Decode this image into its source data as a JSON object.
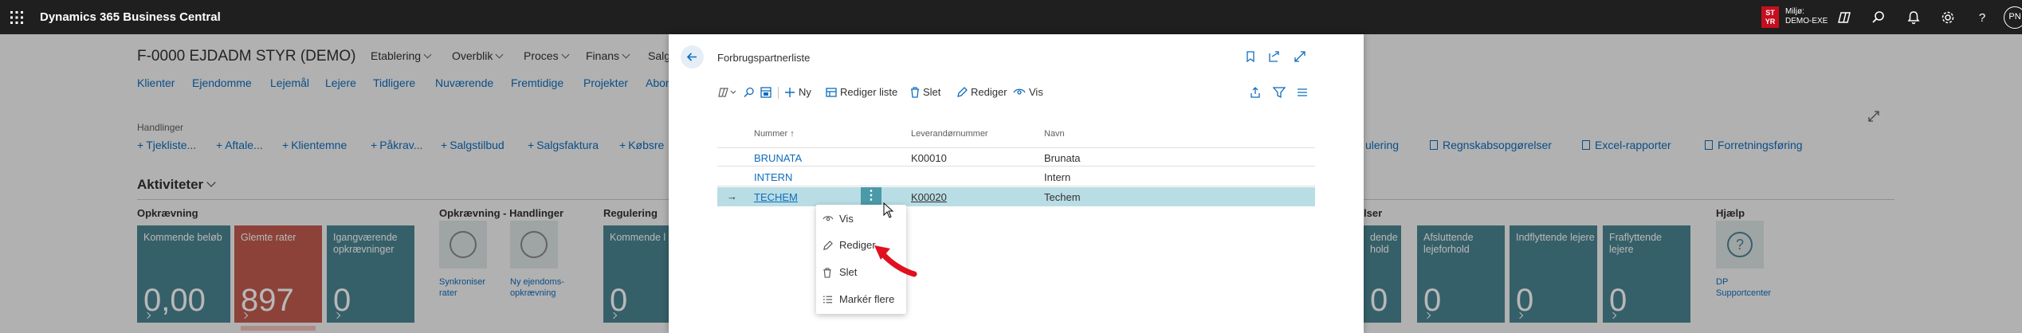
{
  "topbar": {
    "app_title": "Dynamics 365 Business Central",
    "env_badge": "ST\nYR",
    "env_label": "Miljø:",
    "env_name": "DEMO-EXE",
    "user_initials": "PN"
  },
  "page": {
    "title": "F-0000 EJDADM STYR (DEMO)",
    "menus": [
      "Etablering",
      "Overblik",
      "Proces",
      "Finans",
      "Salg"
    ],
    "nav": [
      "Klienter",
      "Ejendomme",
      "Lejemål",
      "Lejere",
      "Tidligere",
      "Nuværende",
      "Fremtidige",
      "Projekter",
      "Abon"
    ],
    "actions_label": "Handlinger",
    "actions": [
      "Tjekliste...",
      "Aftale...",
      "Klientemne",
      "Påkrav...",
      "Salgstilbud",
      "Salgsfaktura",
      "Købsre"
    ],
    "actions_right": [
      "ulering",
      "Regnskabsopgørelser",
      "Excel-rapporter",
      "Forretningsføring"
    ],
    "section_title": "Aktiviteter",
    "groups": {
      "opkraevning": "Opkrævning",
      "opkraevning_handlinger": "Opkrævning - Handlinger",
      "regulering": "Regulering",
      "other": "lser",
      "hjaelp": "Hjælp"
    },
    "tiles_left": [
      {
        "label": "Kommende beløb",
        "value": "0,00",
        "style": "teal"
      },
      {
        "label": "Glemte rater",
        "value": "897",
        "style": "red"
      },
      {
        "label": "Igangværende opkrævninger",
        "value": "0",
        "style": "teal"
      }
    ],
    "circle_actions": [
      {
        "label": "Synkroniser\nrater"
      },
      {
        "label": "Ny ejendoms-\nopkrævning"
      }
    ],
    "tile_regulering": {
      "label": "Kommende l",
      "value": "0"
    },
    "tiles_right": [
      {
        "label": "dende\nhold",
        "value": "0"
      },
      {
        "label": "Afsluttende lejeforhold",
        "value": "0"
      },
      {
        "label": "Indflyttende lejere",
        "value": "0"
      },
      {
        "label": "Fraflyttende lejere",
        "value": "0"
      }
    ],
    "help": {
      "label": "DP\nSupportcenter",
      "icon": "question-icon"
    }
  },
  "dialog": {
    "title": "Forbrugspartnerliste",
    "toolbar": {
      "new": "Ny",
      "edit_list": "Rediger liste",
      "delete": "Slet",
      "edit": "Rediger",
      "view": "Vis"
    },
    "columns": {
      "number": "Nummer",
      "sort": "↑",
      "supplier": "Leverandørnummer",
      "name": "Navn"
    },
    "rows": [
      {
        "number": "BRUNATA",
        "supplier": "K00010",
        "name": "Brunata"
      },
      {
        "number": "INTERN",
        "supplier": "",
        "name": "Intern"
      },
      {
        "number": "TECHEM",
        "supplier": "K00020",
        "name": "Techem"
      }
    ],
    "row_marker": "→",
    "context_menu": [
      "Vis",
      "Rediger",
      "Slet",
      "Markér flere"
    ]
  },
  "colors": {
    "topbar": "#1f1f1f",
    "tile_teal": "#4b8592",
    "tile_red": "#c25c50",
    "link": "#0f6cbd",
    "selected_row": "#b9dde4",
    "annotation_arrow": "#e0101e"
  }
}
